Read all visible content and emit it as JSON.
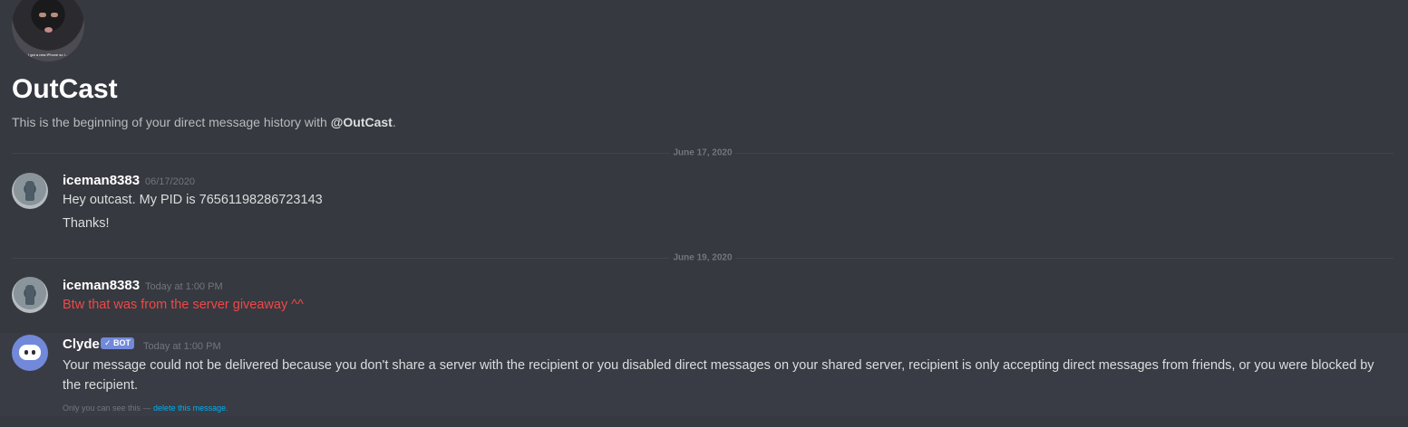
{
  "header": {
    "avatar_caption": "I got a new iPhone so I...",
    "title": "OutCast",
    "intro_prefix": "This is the beginning of your direct message history with ",
    "intro_mention": "@OutCast",
    "intro_suffix": "."
  },
  "dividers": [
    {
      "label": "June 17, 2020"
    },
    {
      "label": "June 19, 2020"
    }
  ],
  "messages": [
    {
      "author": "iceman8383",
      "timestamp": "06/17/2020",
      "lines": [
        "Hey outcast. My PID is 76561198286723143",
        "Thanks!"
      ]
    },
    {
      "author": "iceman8383",
      "timestamp": "Today at 1:00 PM",
      "lines": [
        "Btw that was from the server giveaway ^^"
      ],
      "text_color": "#f04747"
    }
  ],
  "clyde": {
    "author": "Clyde",
    "bot_tag": "✓ BOT",
    "timestamp": "Today at 1:00 PM",
    "text": "Your message could not be delivered because you don't share a server with the recipient or you disabled direct messages on your shared server, recipient is only accepting direct messages from friends, or you were blocked by the recipient.",
    "ephemeral_prefix": "Only you can see this — ",
    "ephemeral_link": "delete this message",
    "ephemeral_suffix": "."
  },
  "colors": {
    "background": "#36393f",
    "ephemeral_background": "#393c44",
    "error_red": "#f04747",
    "blurple": "#7289da",
    "link": "#00b0f4"
  }
}
